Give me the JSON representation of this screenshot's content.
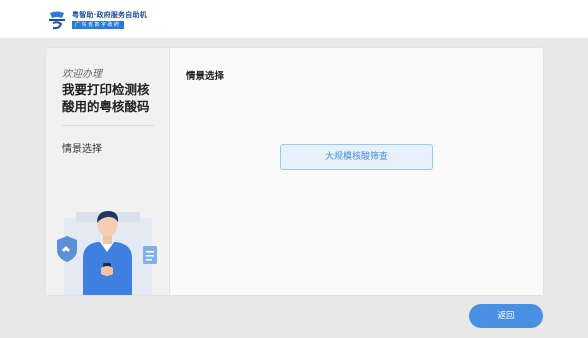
{
  "header": {
    "logo_title": "粤智助·政府服务自助机",
    "logo_subtitle": "广东省数字政府"
  },
  "sidebar": {
    "welcome": "欢迎办理",
    "task_title": "我要打印检测核酸用的粤核酸码",
    "step_label": "情景选择"
  },
  "main": {
    "section_title": "情景选择",
    "option_label": "大规模核酸筛查"
  },
  "footer": {
    "back_label": "返回"
  },
  "colors": {
    "accent": "#4a90e2",
    "option_bg": "#e6f1fc",
    "option_border": "#9ec7ef",
    "brand": "#1d4f9c"
  }
}
